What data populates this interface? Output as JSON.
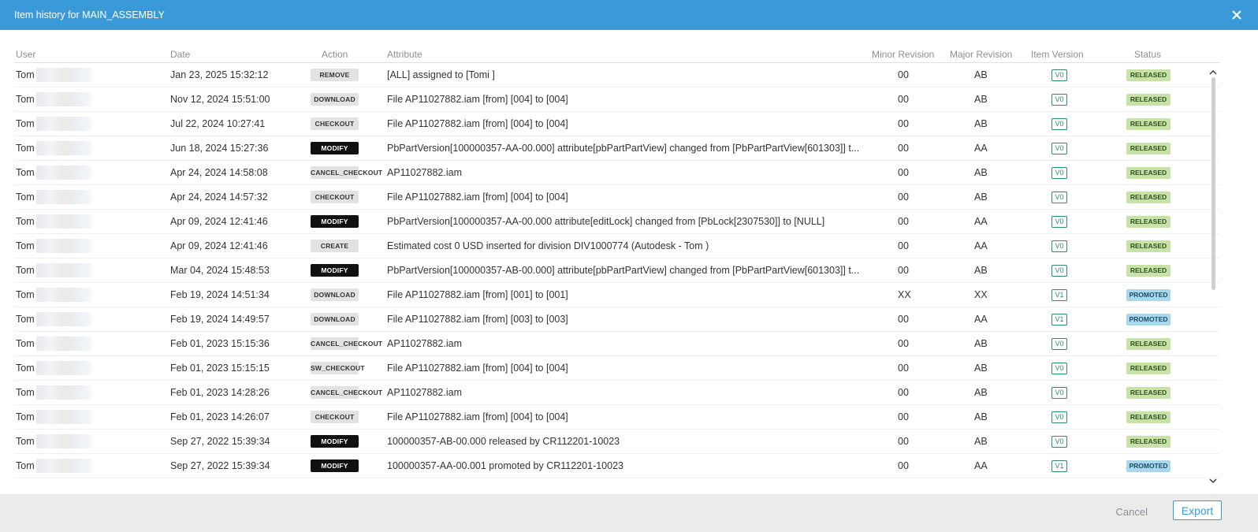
{
  "dialog": {
    "title": "Item history for MAIN_ASSEMBLY"
  },
  "columns": {
    "user": "User",
    "date": "Date",
    "action": "Action",
    "attribute": "Attribute",
    "minor": "Minor Revision",
    "major": "Major Revision",
    "version": "Item Version",
    "status": "Status"
  },
  "rows": [
    {
      "user": "Tom",
      "date": "Jan 23, 2025 15:32:12",
      "action": "REMOVE",
      "action_style": "light",
      "attribute": "[ALL] assigned to [Tomi          ]",
      "minor": "00",
      "major": "AB",
      "version": "V0",
      "status": "RELEASED"
    },
    {
      "user": "Tom",
      "date": "Nov 12, 2024 15:51:00",
      "action": "DOWNLOAD",
      "action_style": "light",
      "attribute": "File AP11027882.iam [from] [004] to [004]",
      "minor": "00",
      "major": "AB",
      "version": "V0",
      "status": "RELEASED"
    },
    {
      "user": "Tom",
      "date": "Jul 22, 2024 10:27:41",
      "action": "CHECKOUT",
      "action_style": "light",
      "attribute": "File AP11027882.iam [from] [004] to [004]",
      "minor": "00",
      "major": "AB",
      "version": "V0",
      "status": "RELEASED"
    },
    {
      "user": "Tom",
      "date": "Jun 18, 2024 15:27:36",
      "action": "MODIFY",
      "action_style": "dark",
      "attribute": "PbPartVersion[100000357-AA-00.000] attribute[pbPartPartView] changed from [PbPartPartView[601303]] t...",
      "minor": "00",
      "major": "AA",
      "version": "V0",
      "status": "RELEASED"
    },
    {
      "user": "Tom",
      "date": "Apr 24, 2024 14:58:08",
      "action": "CANCEL_CHECKOUT",
      "action_style": "light",
      "attribute": "AP11027882.iam",
      "minor": "00",
      "major": "AB",
      "version": "V0",
      "status": "RELEASED"
    },
    {
      "user": "Tom",
      "date": "Apr 24, 2024 14:57:32",
      "action": "CHECKOUT",
      "action_style": "light",
      "attribute": "File AP11027882.iam [from] [004] to [004]",
      "minor": "00",
      "major": "AB",
      "version": "V0",
      "status": "RELEASED"
    },
    {
      "user": "Tom",
      "date": "Apr 09, 2024 12:41:46",
      "action": "MODIFY",
      "action_style": "dark",
      "attribute": "PbPartVersion[100000357-AA-00.000 attribute[editLock] changed from [PbLock[2307530]] to [NULL]",
      "minor": "00",
      "major": "AA",
      "version": "V0",
      "status": "RELEASED"
    },
    {
      "user": "Tom",
      "date": "Apr 09, 2024 12:41:46",
      "action": "CREATE",
      "action_style": "light",
      "attribute": "Estimated cost 0 USD inserted for division DIV1000774 (Autodesk - Tom               )",
      "minor": "00",
      "major": "AA",
      "version": "V0",
      "status": "RELEASED"
    },
    {
      "user": "Tom",
      "date": "Mar 04, 2024 15:48:53",
      "action": "MODIFY",
      "action_style": "dark",
      "attribute": "PbPartVersion[100000357-AB-00.000] attribute[pbPartPartView] changed from [PbPartPartView[601303]] t...",
      "minor": "00",
      "major": "AB",
      "version": "V0",
      "status": "RELEASED"
    },
    {
      "user": "Tom",
      "date": "Feb 19, 2024 14:51:34",
      "action": "DOWNLOAD",
      "action_style": "light",
      "attribute": "File AP11027882.iam [from] [001] to [001]",
      "minor": "XX",
      "major": "XX",
      "version": "V1",
      "status": "PROMOTED"
    },
    {
      "user": "Tom",
      "date": "Feb 19, 2024 14:49:57",
      "action": "DOWNLOAD",
      "action_style": "light",
      "attribute": "File AP11027882.iam [from] [003] to [003]",
      "minor": "00",
      "major": "AA",
      "version": "V1",
      "status": "PROMOTED"
    },
    {
      "user": "Tom",
      "date": "Feb 01, 2023 15:15:36",
      "action": "CANCEL_CHECKOUT",
      "action_style": "light",
      "attribute": "AP11027882.iam",
      "minor": "00",
      "major": "AB",
      "version": "V0",
      "status": "RELEASED"
    },
    {
      "user": "Tom",
      "date": "Feb 01, 2023 15:15:15",
      "action": "SW_CHECKOUT",
      "action_style": "light",
      "attribute": "File AP11027882.iam [from] [004] to [004]",
      "minor": "00",
      "major": "AB",
      "version": "V0",
      "status": "RELEASED"
    },
    {
      "user": "Tom",
      "date": "Feb 01, 2023 14:28:26",
      "action": "CANCEL_CHECKOUT",
      "action_style": "light",
      "attribute": "AP11027882.iam",
      "minor": "00",
      "major": "AB",
      "version": "V0",
      "status": "RELEASED"
    },
    {
      "user": "Tom",
      "date": "Feb 01, 2023 14:26:07",
      "action": "CHECKOUT",
      "action_style": "light",
      "attribute": "File AP11027882.iam [from] [004] to [004]",
      "minor": "00",
      "major": "AB",
      "version": "V0",
      "status": "RELEASED"
    },
    {
      "user": "Tom",
      "date": "Sep 27, 2022 15:39:34",
      "action": "MODIFY",
      "action_style": "dark",
      "attribute": "100000357-AB-00.000 released by CR112201-10023",
      "minor": "00",
      "major": "AB",
      "version": "V0",
      "status": "RELEASED"
    },
    {
      "user": "Tom",
      "date": "Sep 27, 2022 15:39:34",
      "action": "MODIFY",
      "action_style": "dark",
      "attribute": "100000357-AA-00.001 promoted by CR112201-10023",
      "minor": "00",
      "major": "AA",
      "version": "V1",
      "status": "PROMOTED"
    }
  ],
  "footer": {
    "cancel_label": "Cancel",
    "export_label": "Export"
  },
  "colors": {
    "titlebar": "#3a9ad9",
    "released": "#c6e2a6",
    "promoted": "#a9d8ec",
    "version_border": "#2e8b6f"
  }
}
